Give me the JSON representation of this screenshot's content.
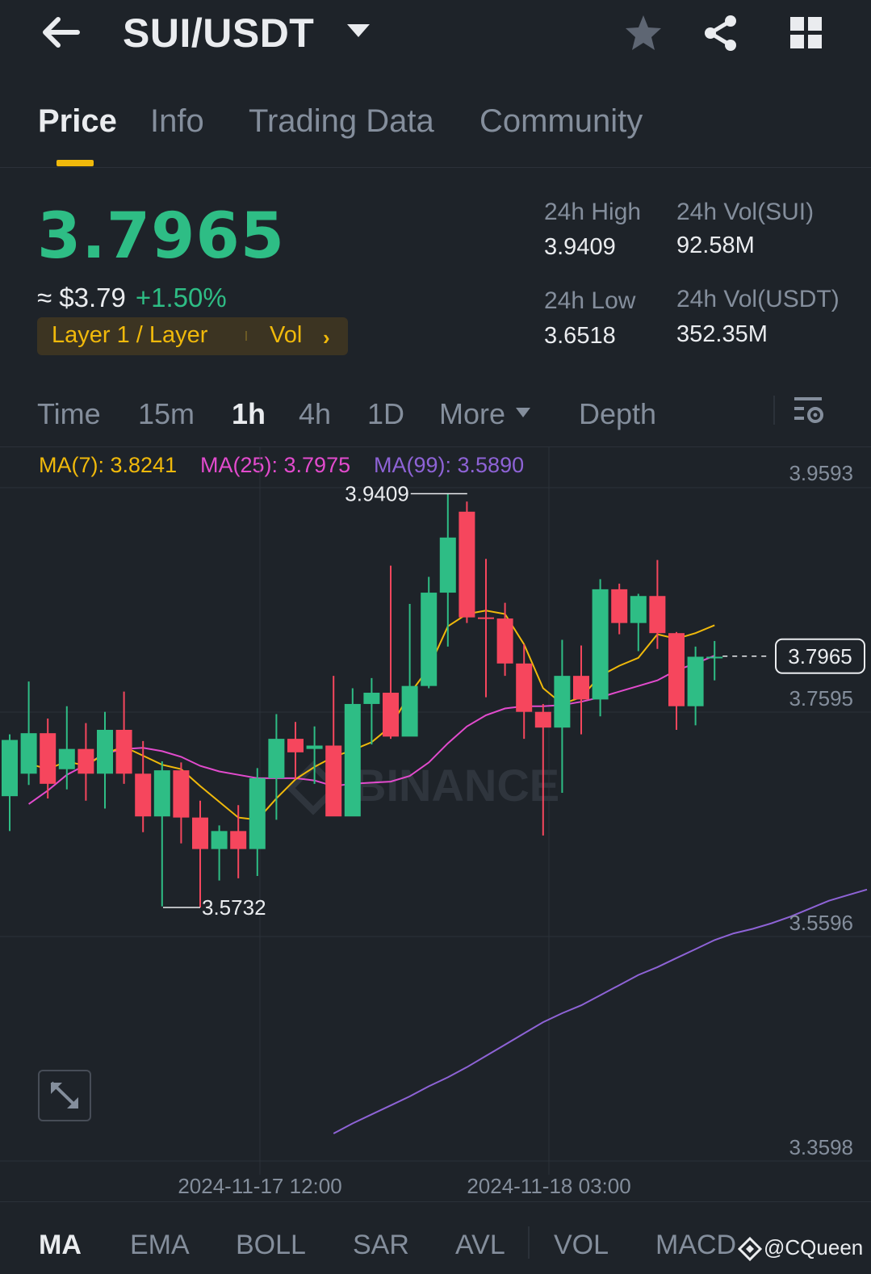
{
  "header": {
    "pair": "SUI/USDT",
    "icons": [
      "back-arrow-icon",
      "caret-down-icon",
      "star-icon",
      "share-icon",
      "grid-icon"
    ]
  },
  "tabs": [
    "Price",
    "Info",
    "Trading Data",
    "Community"
  ],
  "active_tab": "Price",
  "ticker": {
    "last_price": "3.7965",
    "usd_price": "≈ $3.79",
    "change_pct": "+1.50%",
    "tag": "Layer 1 / Layer",
    "tag_sort": "Vol",
    "high_label": "24h High",
    "high": "3.9409",
    "low_label": "24h Low",
    "low": "3.6518",
    "vol_base_label": "24h Vol(SUI)",
    "vol_base": "92.58M",
    "vol_quote_label": "24h Vol(USDT)",
    "vol_quote": "352.35M"
  },
  "intervals": [
    "Time",
    "15m",
    "1h",
    "4h",
    "1D",
    "More",
    "Depth"
  ],
  "active_interval": "1h",
  "ma": {
    "ma7": "MA(7): 3.8241",
    "ma25": "MA(25): 3.7975",
    "ma99": "MA(99): 3.5890"
  },
  "colors": {
    "background": "#1e2329",
    "up": "#2ebd85",
    "down": "#f6465d",
    "accent": "#f0b90b",
    "ma7": "#f0b90b",
    "ma25": "#e24bcd",
    "ma99": "#8e63d6",
    "muted": "#848e9c"
  },
  "chart_data": {
    "type": "candlestick",
    "ylim": [
      3.3598,
      3.9593
    ],
    "y_ticks": [
      "3.9593",
      "3.7595",
      "3.5596",
      "3.3598"
    ],
    "x_ticks": [
      "2024-11-17 12:00",
      "2024-11-18 03:00"
    ],
    "current_price_label": "3.7965",
    "max_label": "3.9409",
    "min_label": "3.5732",
    "candles": [
      {
        "o": 3.672,
        "h": 3.727,
        "l": 3.641,
        "c": 3.722
      },
      {
        "o": 3.692,
        "h": 3.774,
        "l": 3.682,
        "c": 3.728
      },
      {
        "o": 3.728,
        "h": 3.741,
        "l": 3.67,
        "c": 3.683
      },
      {
        "o": 3.696,
        "h": 3.752,
        "l": 3.678,
        "c": 3.714
      },
      {
        "o": 3.714,
        "h": 3.737,
        "l": 3.668,
        "c": 3.692
      },
      {
        "o": 3.692,
        "h": 3.747,
        "l": 3.661,
        "c": 3.731
      },
      {
        "o": 3.731,
        "h": 3.765,
        "l": 3.683,
        "c": 3.692
      },
      {
        "o": 3.692,
        "h": 3.721,
        "l": 3.64,
        "c": 3.654
      },
      {
        "o": 3.654,
        "h": 3.703,
        "l": 3.574,
        "c": 3.695
      },
      {
        "o": 3.695,
        "h": 3.702,
        "l": 3.63,
        "c": 3.653
      },
      {
        "o": 3.653,
        "h": 3.668,
        "l": 3.573,
        "c": 3.625
      },
      {
        "o": 3.625,
        "h": 3.646,
        "l": 3.597,
        "c": 3.641
      },
      {
        "o": 3.641,
        "h": 3.664,
        "l": 3.599,
        "c": 3.625
      },
      {
        "o": 3.625,
        "h": 3.697,
        "l": 3.601,
        "c": 3.688
      },
      {
        "o": 3.688,
        "h": 3.745,
        "l": 3.651,
        "c": 3.723
      },
      {
        "o": 3.723,
        "h": 3.738,
        "l": 3.687,
        "c": 3.711
      },
      {
        "o": 3.714,
        "h": 3.734,
        "l": 3.683,
        "c": 3.717
      },
      {
        "o": 3.717,
        "h": 3.779,
        "l": 3.657,
        "c": 3.654
      },
      {
        "o": 3.654,
        "h": 3.768,
        "l": 3.668,
        "c": 3.754
      },
      {
        "o": 3.754,
        "h": 3.777,
        "l": 3.718,
        "c": 3.764
      },
      {
        "o": 3.764,
        "h": 3.877,
        "l": 3.723,
        "c": 3.725
      },
      {
        "o": 3.725,
        "h": 3.843,
        "l": 3.728,
        "c": 3.77
      },
      {
        "o": 3.77,
        "h": 3.867,
        "l": 3.768,
        "c": 3.853
      },
      {
        "o": 3.853,
        "h": 3.941,
        "l": 3.805,
        "c": 3.902
      },
      {
        "o": 3.925,
        "h": 3.934,
        "l": 3.826,
        "c": 3.831
      },
      {
        "o": 3.831,
        "h": 3.883,
        "l": 3.76,
        "c": 3.83
      },
      {
        "o": 3.83,
        "h": 3.844,
        "l": 3.779,
        "c": 3.79
      },
      {
        "o": 3.79,
        "h": 3.807,
        "l": 3.723,
        "c": 3.747
      },
      {
        "o": 3.747,
        "h": 3.754,
        "l": 3.637,
        "c": 3.733
      },
      {
        "o": 3.733,
        "h": 3.811,
        "l": 3.675,
        "c": 3.779
      },
      {
        "o": 3.779,
        "h": 3.806,
        "l": 3.727,
        "c": 3.758
      },
      {
        "o": 3.758,
        "h": 3.865,
        "l": 3.743,
        "c": 3.856
      },
      {
        "o": 3.856,
        "h": 3.861,
        "l": 3.816,
        "c": 3.826
      },
      {
        "o": 3.826,
        "h": 3.852,
        "l": 3.801,
        "c": 3.85
      },
      {
        "o": 3.85,
        "h": 3.882,
        "l": 3.803,
        "c": 3.817
      },
      {
        "o": 3.817,
        "h": 3.818,
        "l": 3.731,
        "c": 3.752
      },
      {
        "o": 3.752,
        "h": 3.805,
        "l": 3.735,
        "c": 3.796
      },
      {
        "o": 3.796,
        "h": 3.81,
        "l": 3.775,
        "c": 3.796
      }
    ],
    "ma7": [
      3.701,
      3.696,
      3.703,
      3.699,
      3.71,
      3.716,
      3.708,
      3.7,
      3.696,
      3.681,
      3.667,
      3.653,
      3.651,
      3.67,
      3.687,
      3.698,
      3.707,
      3.713,
      3.72,
      3.734,
      3.763,
      3.786,
      3.823,
      3.834,
      3.837,
      3.834,
      3.807,
      3.768,
      3.754,
      3.76,
      3.779,
      3.788,
      3.795,
      3.816,
      3.812,
      3.817,
      3.824
    ],
    "ma25": [
      3.665,
      3.677,
      3.691,
      3.7,
      3.71,
      3.714,
      3.715,
      3.712,
      3.707,
      3.699,
      3.694,
      3.691,
      3.688,
      3.688,
      3.688,
      3.686,
      3.681,
      3.683,
      3.684,
      3.685,
      3.69,
      3.702,
      3.719,
      3.734,
      3.744,
      3.75,
      3.752,
      3.752,
      3.753,
      3.756,
      3.76,
      3.765,
      3.77,
      3.775,
      3.784,
      3.79,
      3.797
    ],
    "ma99": [
      3.372,
      3.381,
      3.389,
      3.397,
      3.405,
      3.414,
      3.422,
      3.431,
      3.441,
      3.451,
      3.461,
      3.471,
      3.479,
      3.486,
      3.495,
      3.504,
      3.513,
      3.52,
      3.528,
      3.536,
      3.544,
      3.55,
      3.554,
      3.559,
      3.565,
      3.572,
      3.579,
      3.584,
      3.589
    ]
  },
  "indicators": [
    "MA",
    "EMA",
    "BOLL",
    "SAR",
    "AVL",
    "VOL",
    "MACD"
  ],
  "active_indicator": "MA",
  "watermark": "@CQueen",
  "chart_watermark": "BINANCE"
}
